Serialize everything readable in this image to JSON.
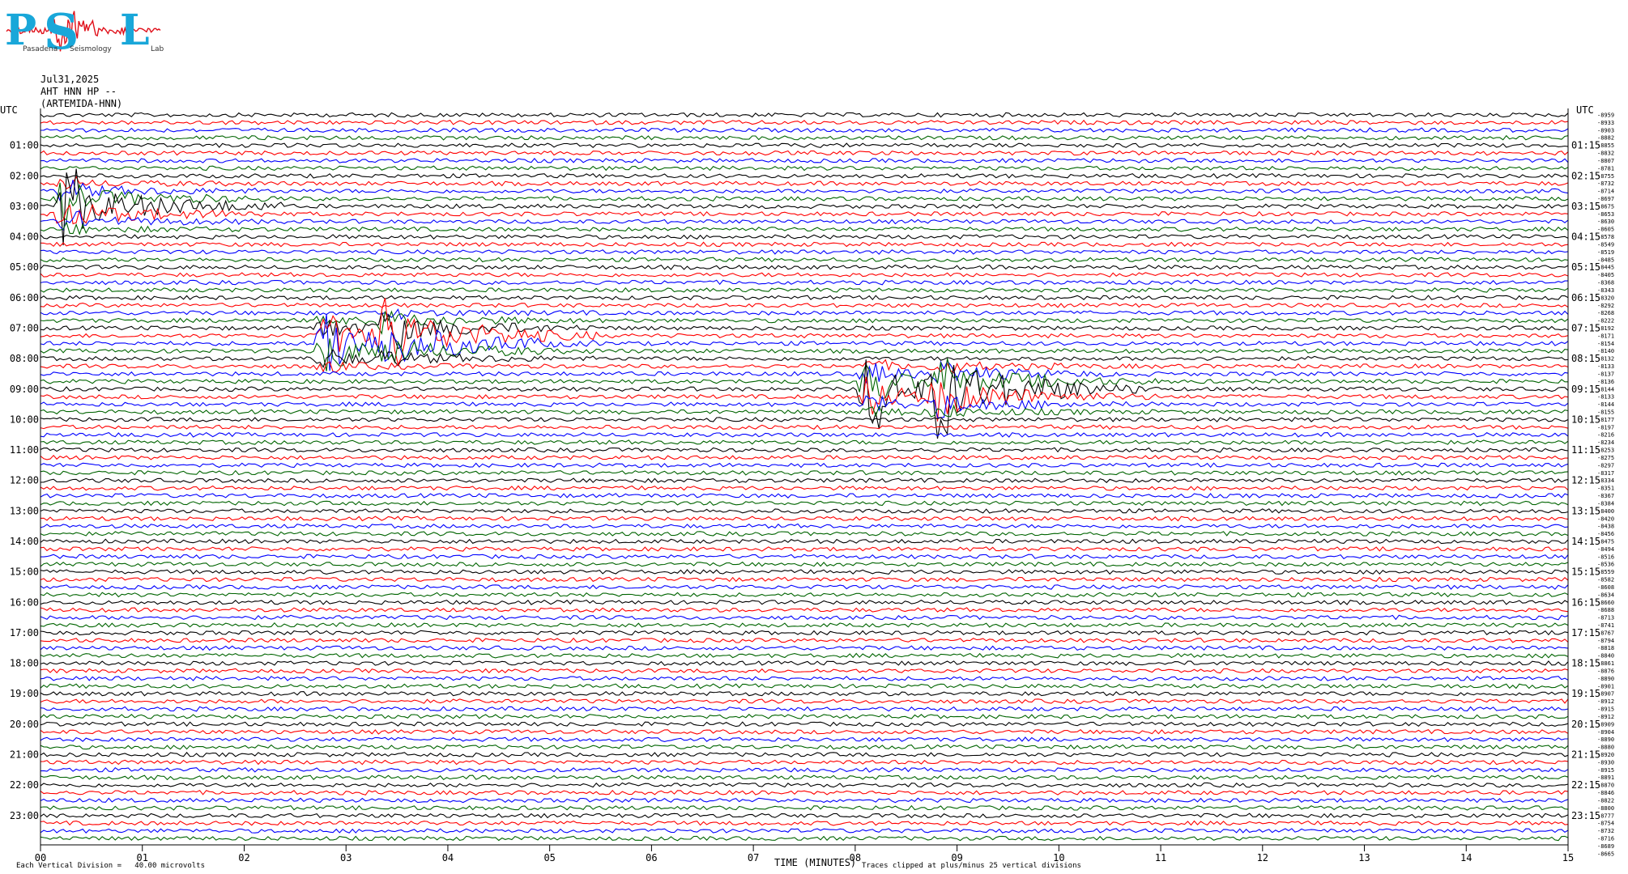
{
  "logo": {
    "letters": [
      "P",
      "S",
      "L"
    ],
    "small_words": [
      "Pasadena",
      "Seismology",
      "Lab"
    ],
    "waveform_color": "#e0101a",
    "letter_color": "#19a7d9"
  },
  "header": {
    "date": "Jul31,2025",
    "station": "AHT HNN HP --",
    "site": "(ARTEMIDA-HNN)",
    "utc_label_left": "UTC",
    "utc_label_right": "UTC"
  },
  "footer": {
    "division": "Each Vertical Division =   40.00 microvolts",
    "xlabel": "TIME (MINUTES)",
    "clip_note": "Traces clipped at plus/minus 25 vertical divisions"
  },
  "chart_data": {
    "type": "line",
    "title": "",
    "xlabel": "TIME (MINUTES)",
    "ylabel": "UTC",
    "xlim": [
      0,
      15
    ],
    "x_ticks": [
      "00",
      "01",
      "02",
      "03",
      "04",
      "05",
      "06",
      "07",
      "08",
      "09",
      "10",
      "11",
      "12",
      "13",
      "14",
      "15"
    ],
    "hour_labels_left": [
      "01:00",
      "02:00",
      "03:00",
      "04:00",
      "05:00",
      "06:00",
      "07:00",
      "08:00",
      "09:00",
      "10:00",
      "11:00",
      "12:00",
      "13:00",
      "14:00",
      "15:00",
      "16:00",
      "17:00",
      "18:00",
      "19:00",
      "20:00",
      "21:00",
      "22:00",
      "23:00"
    ],
    "hour_labels_right": [
      "01:15",
      "02:15",
      "03:15",
      "04:15",
      "05:15",
      "06:15",
      "07:15",
      "08:15",
      "09:15",
      "10:15",
      "11:15",
      "12:15",
      "13:15",
      "14:15",
      "15:15",
      "16:15",
      "17:15",
      "18:15",
      "19:15",
      "20:15",
      "21:15",
      "22:15",
      "23:15"
    ],
    "trace_count": 96,
    "trace_minutes": 15,
    "trace_colors": [
      "#000000",
      "#ff0000",
      "#0000ff",
      "#006400"
    ],
    "trace_offsets": [
      -8959,
      -8933,
      -8903,
      -8882,
      -8855,
      -8832,
      -8807,
      -8781,
      -8755,
      -8732,
      -8714,
      -8697,
      -8675,
      -8653,
      -8630,
      -8605,
      -8578,
      -8549,
      -8519,
      -8485,
      -8445,
      -8405,
      -8368,
      -8343,
      -8320,
      -8292,
      -8268,
      -8222,
      -8192,
      -8171,
      -8154,
      -8140,
      -8132,
      -8133,
      -8137,
      -8136,
      -8144,
      -8133,
      -8144,
      -8155,
      -8177,
      -8197,
      -8216,
      -8234,
      -8253,
      -8275,
      -8297,
      -8317,
      -8334,
      -8351,
      -8367,
      -8384,
      -8400,
      -8420,
      -8438,
      -8456,
      -8475,
      -8494,
      -8516,
      -8536,
      -8559,
      -8582,
      -8608,
      -8634,
      -8660,
      -8688,
      -8713,
      -8741,
      -8767,
      -8794,
      -8818,
      -8840,
      -8861,
      -8876,
      -8890,
      -8901,
      -8907,
      -8912,
      -8915,
      -8912,
      -8909,
      -8904,
      -8890,
      -8880,
      -8920,
      -8930,
      -8915,
      -8891,
      -8870,
      -8846,
      -8822,
      -8800,
      -8777,
      -8754,
      -8732,
      -8716,
      -8689,
      -8665
    ],
    "events": [
      {
        "time": "09:00",
        "minute": 8.9,
        "color": "#006400"
      },
      {
        "time": "07:30",
        "minute": 2.85,
        "color": "#0000ff"
      },
      {
        "time": "07:15",
        "minute": 3.45,
        "color": "#006400"
      },
      {
        "time": "09:00",
        "minute": 8.2,
        "color": "#0000ff"
      },
      {
        "time": "03:00",
        "minute": 0.3,
        "color": "#ff0000"
      }
    ],
    "grid": false,
    "legend": "none"
  }
}
